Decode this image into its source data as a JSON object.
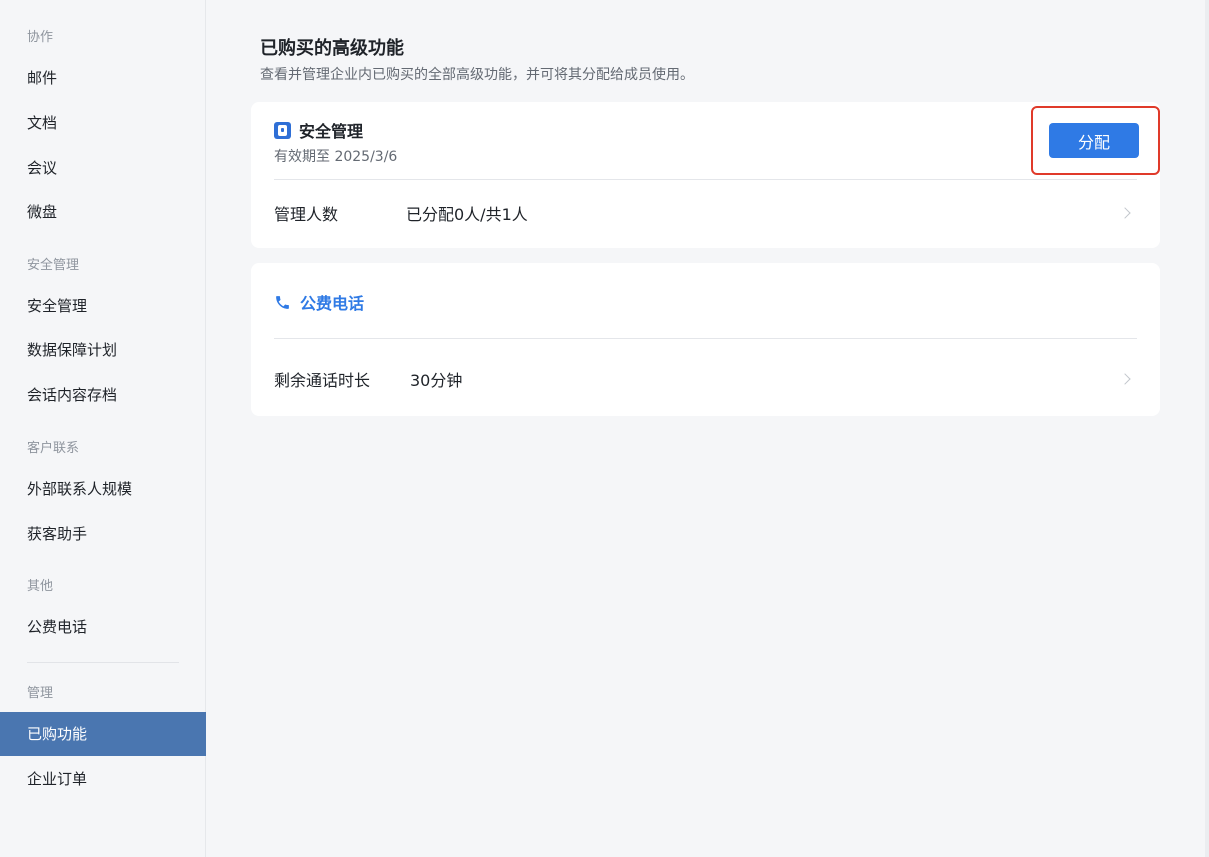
{
  "sidebar": {
    "groups": {
      "collab": "协作",
      "security": "安全管理",
      "customer": "客户联系",
      "other": "其他",
      "manage": "管理"
    },
    "items": {
      "mail": "邮件",
      "docs": "文档",
      "meeting": "会议",
      "drive": "微盘",
      "security_mgmt": "安全管理",
      "data_plan": "数据保障计划",
      "chat_archive": "会话内容存档",
      "external_contacts": "外部联系人规模",
      "acquisition": "获客助手",
      "public_phone": "公费电话",
      "purchased": "已购功能",
      "orders": "企业订单"
    },
    "active_item": "已购功能",
    "active_color": "#4a76b0"
  },
  "main": {
    "title": "已购买的高级功能",
    "subtitle": "查看并管理企业内已购买的全部高级功能，并可将其分配给成员使用。",
    "security_card": {
      "icon": "security-shield-icon",
      "title": "安全管理",
      "expiry": "有效期至 2025/3/6",
      "assign_label": "分配",
      "row_label": "管理人数",
      "row_value": "已分配0人/共1人"
    },
    "phone_card": {
      "icon": "phone-icon",
      "title": "公费电话",
      "row_label": "剩余通话时长",
      "row_value": "30分钟"
    }
  },
  "colors": {
    "accent": "#2f7ae5",
    "highlight_border": "#e03a2a"
  }
}
